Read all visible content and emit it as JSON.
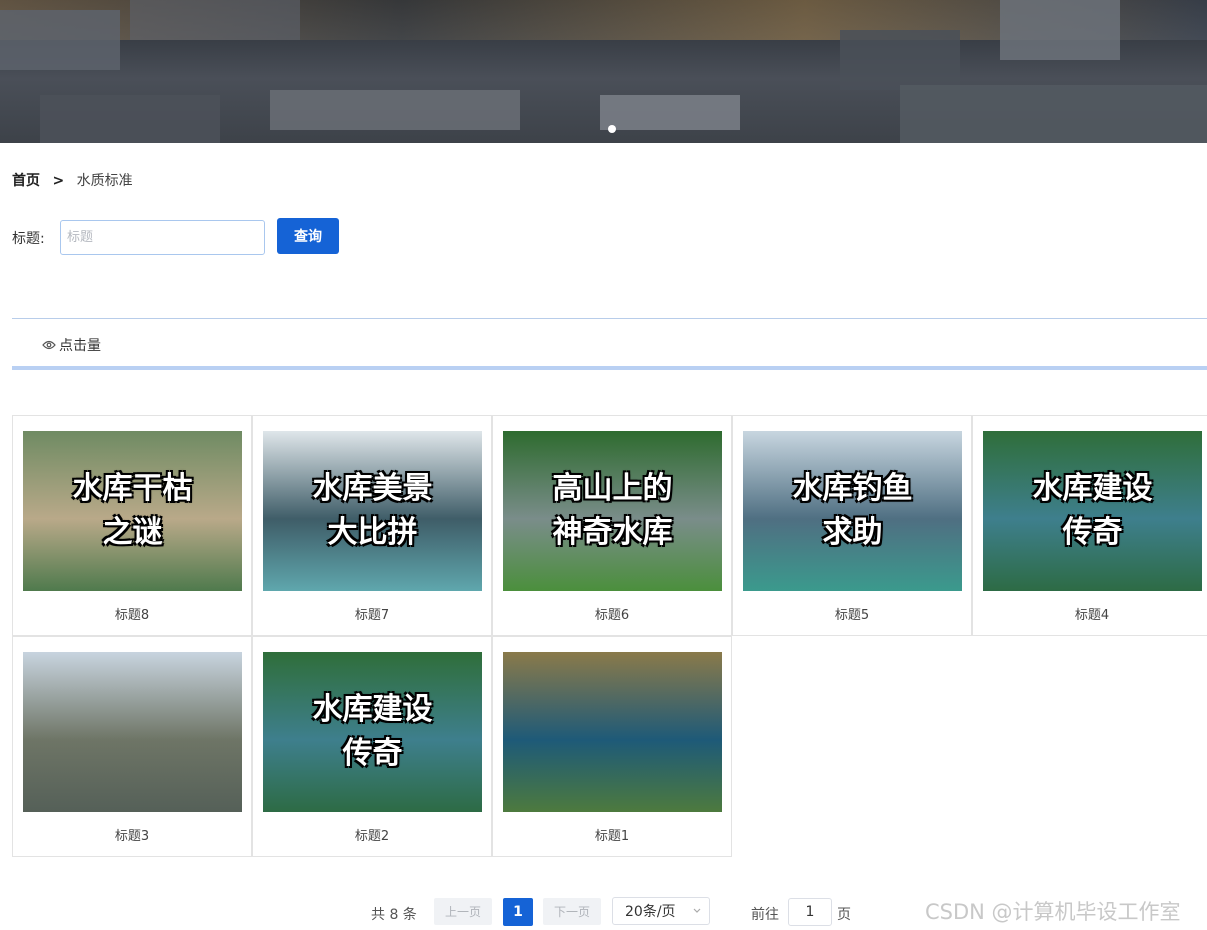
{
  "banner": {
    "image": "city-night-aerial"
  },
  "breadcrumb": {
    "home": "首页",
    "separator": ">",
    "current": "水质标准"
  },
  "search": {
    "label": "标题:",
    "placeholder": "标题",
    "button": "查询"
  },
  "sort": {
    "click_label": "点击量"
  },
  "cards": [
    {
      "title": "标题8",
      "overlay": "水库干枯\n之谜",
      "colors": [
        "#6f8b63",
        "#b9a989",
        "#4f7a4d"
      ]
    },
    {
      "title": "标题7",
      "overlay": "水库美景\n大比拼",
      "colors": [
        "#dfe6ea",
        "#3f5d68",
        "#5fa7ad"
      ]
    },
    {
      "title": "标题6",
      "overlay": "高山上的\n神奇水库",
      "colors": [
        "#2e6b2f",
        "#7a8d8a",
        "#4b8f3c"
      ]
    },
    {
      "title": "标题5",
      "overlay": "水库钓鱼\n求助",
      "colors": [
        "#c8d6e0",
        "#4f6f82",
        "#3b9a8d"
      ]
    },
    {
      "title": "标题4",
      "overlay": "水库建设\n传奇",
      "colors": [
        "#2f6e3a",
        "#3e7f8d",
        "#2d6b45"
      ]
    },
    {
      "title": "标题3",
      "overlay": "",
      "colors": [
        "#c8d4df",
        "#6e7566",
        "#556058"
      ]
    },
    {
      "title": "标题2",
      "overlay": "水库建设\n传奇",
      "colors": [
        "#2f6e3a",
        "#3e7f8d",
        "#2d6b45"
      ]
    },
    {
      "title": "标题1",
      "overlay": "",
      "colors": [
        "#8a7a4a",
        "#1e5a78",
        "#4d7a3e"
      ]
    }
  ],
  "pagination": {
    "total": "共 8 条",
    "prev": "上一页",
    "current": "1",
    "next": "下一页",
    "page_size": "20条/页",
    "goto_label": "前往",
    "goto_value": "1",
    "page_suffix": "页"
  },
  "watermark": "CSDN @计算机毕设工作室"
}
